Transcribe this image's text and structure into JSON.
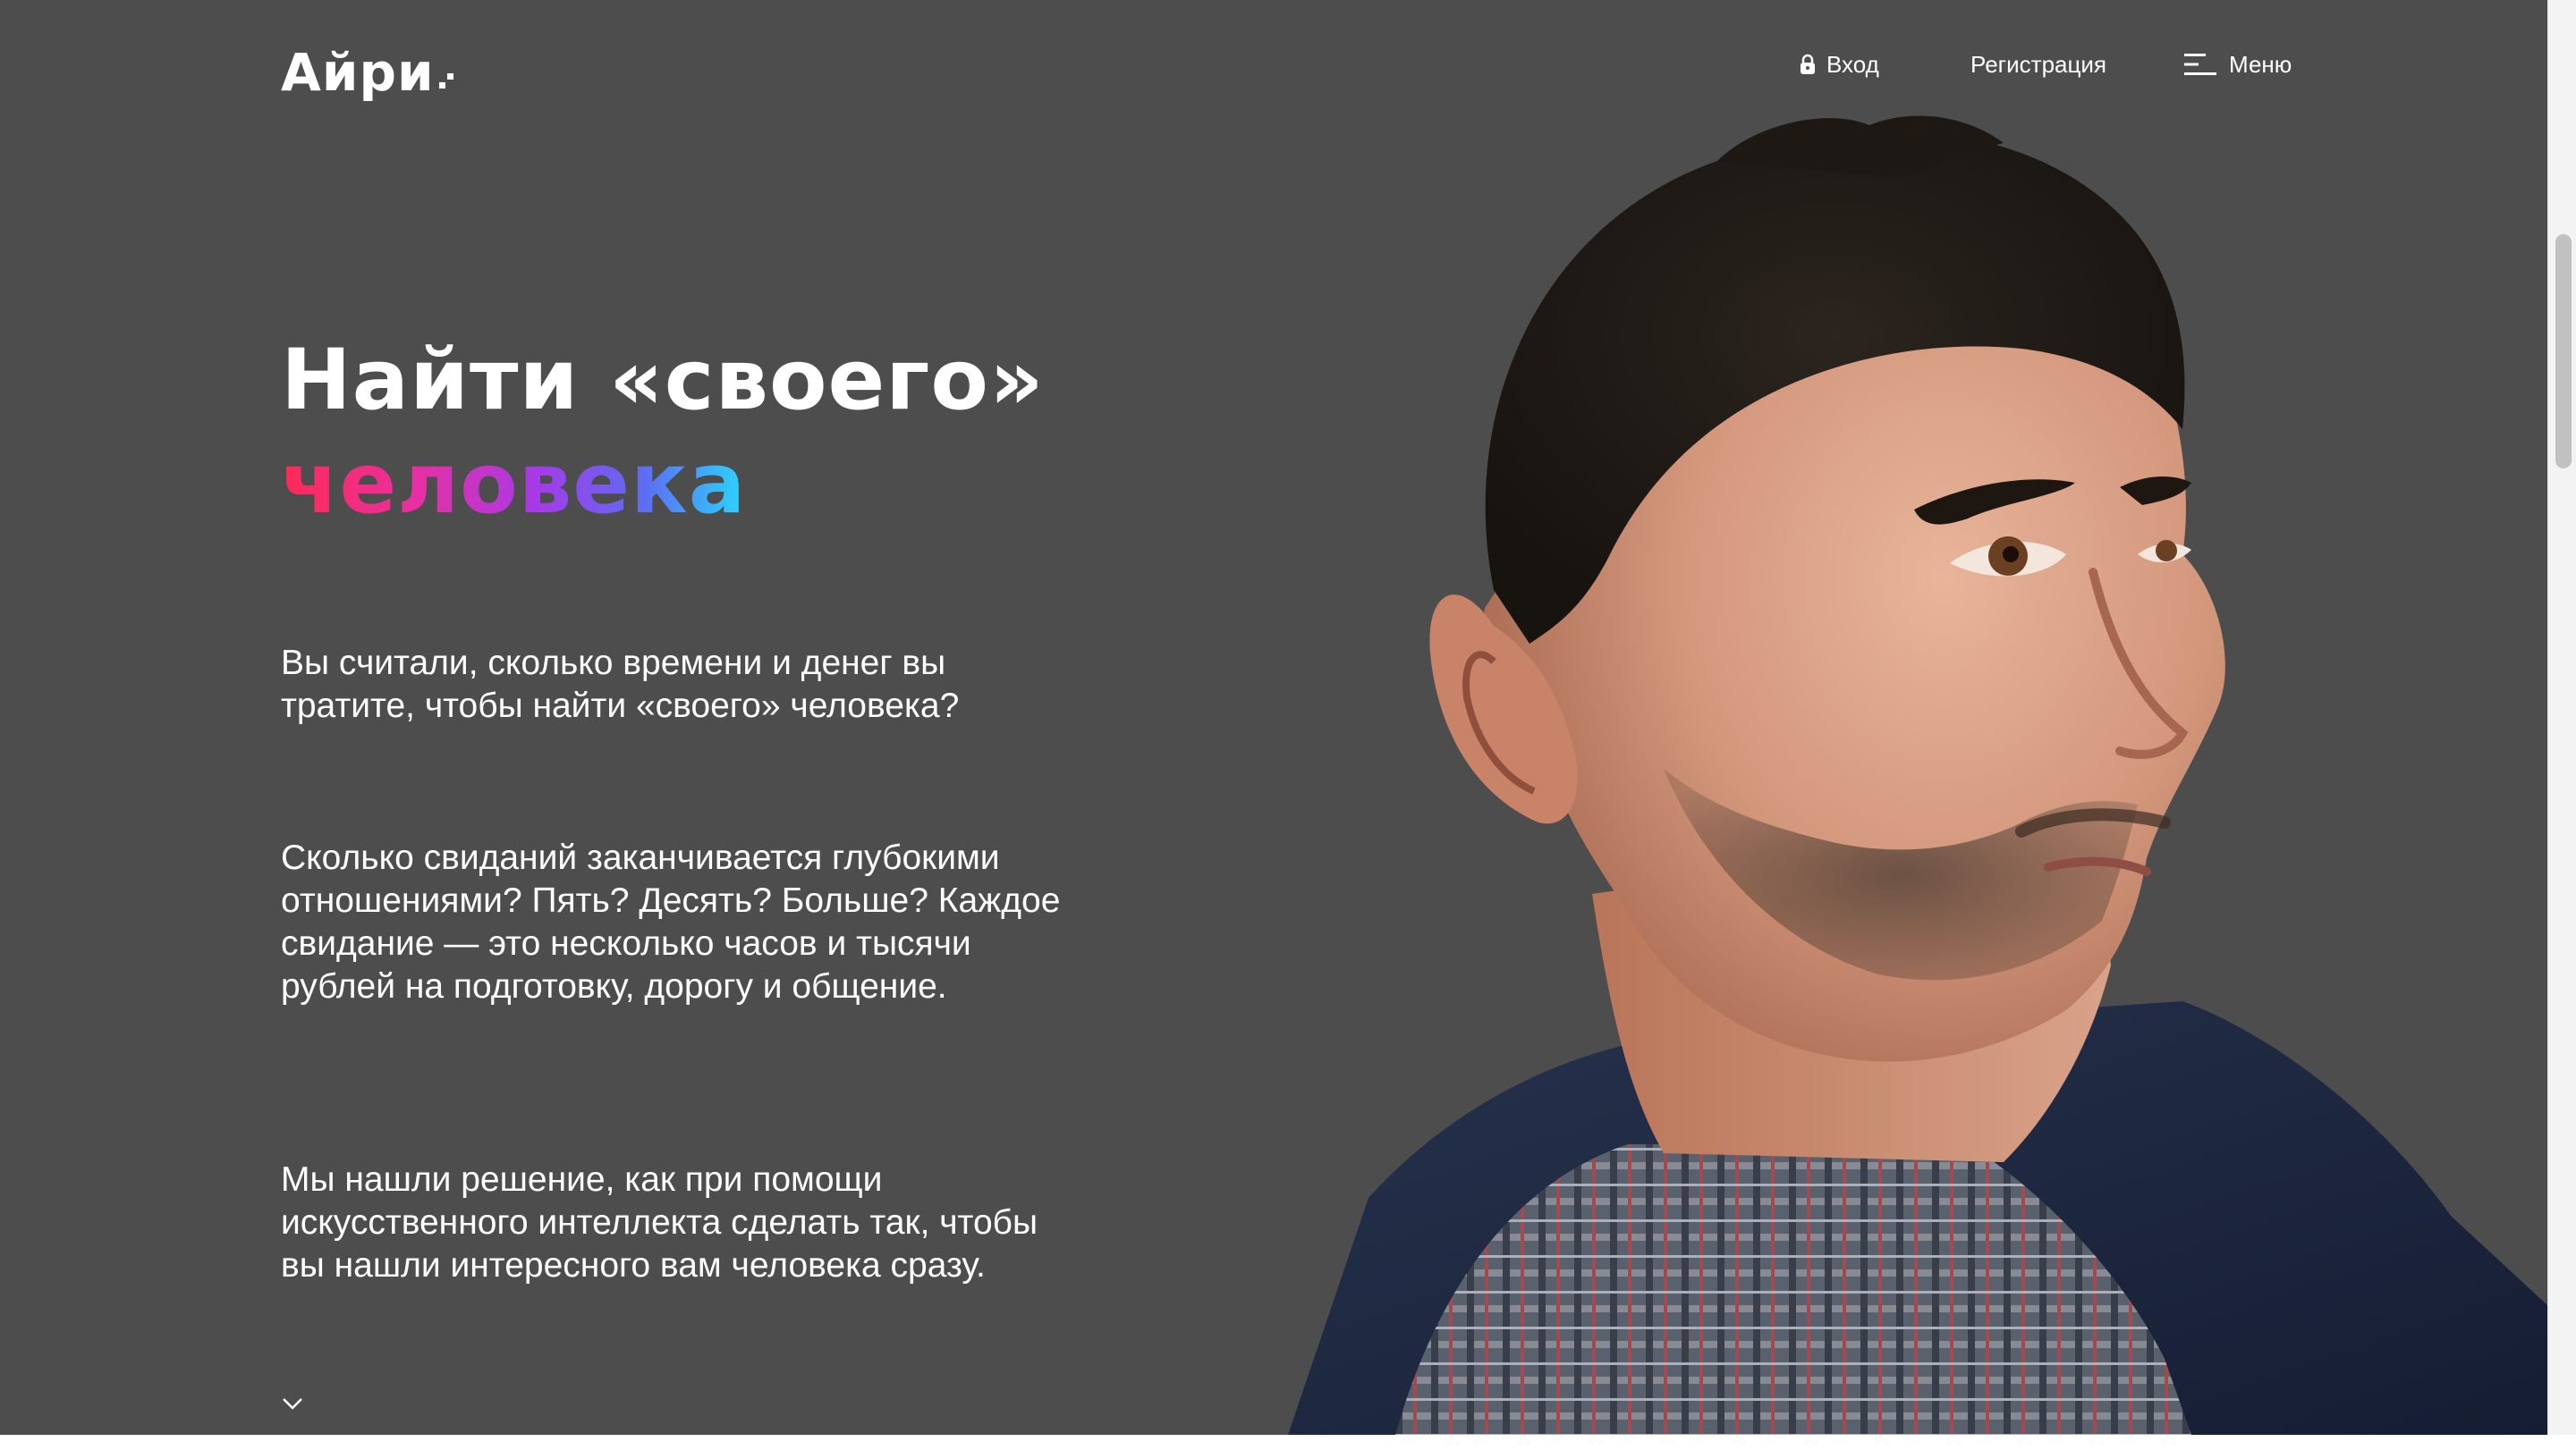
{
  "header": {
    "logo_text": "Айри",
    "login_label": "Вход",
    "register_label": "Регистрация",
    "menu_label": "Меню"
  },
  "hero": {
    "title_line1": "Найти «своего»",
    "title_line2": "человека",
    "paragraphs": [
      "Вы считали, сколько времени и денег вы тратите, чтобы найти «своего» человека?",
      "Сколько свиданий заканчивается глубокими отношениями? Пять? Десять? Больше? Каждое свидание — это несколько часов и тысячи рублей на подготовку, дорогу и общение.",
      "Мы нашли решение, как при помощи искусственного интеллекта сделать так, чтобы вы нашли интересного вам человека сразу."
    ]
  },
  "icons": {
    "login": "lock-icon",
    "menu": "hamburger-menu-icon",
    "scroll": "chevron-down-icon"
  },
  "colors": {
    "background": "#4d4d4d",
    "text": "#ffffff",
    "gradient": [
      "#ff2a55",
      "#e930a0",
      "#a63ae8",
      "#5d6cf2",
      "#2ad6ff"
    ]
  }
}
